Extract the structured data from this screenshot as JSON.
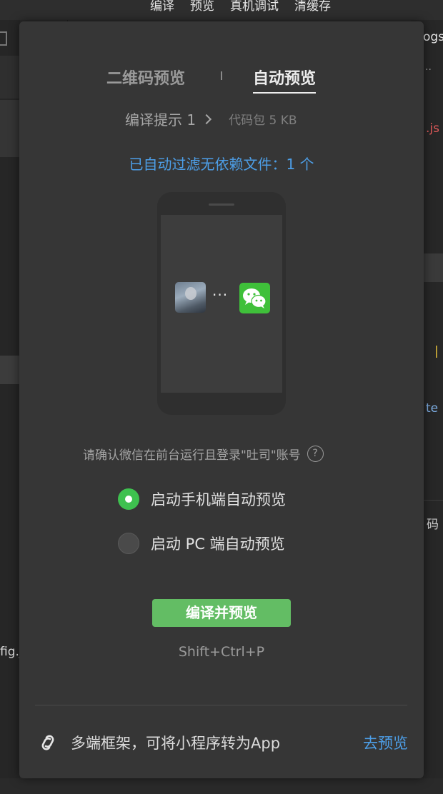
{
  "background": {
    "menu": [
      "编译",
      "预览",
      "真机调试",
      "清缓存"
    ],
    "right_snippets": [
      {
        "text": "ogs",
        "color": "#e6e6e6"
      },
      {
        "text": "..",
        "color": "#9a9a9a"
      },
      {
        "text": ".js",
        "color": "#e05a5a"
      },
      {
        "text": "|",
        "color": "#e8c23a"
      },
      {
        "text": "te",
        "color": "#7fb0e6"
      },
      {
        "text": "码",
        "color": "#cfcfcf"
      }
    ],
    "left_snippet": "fig.j"
  },
  "tabs": {
    "qr": "二维码预览",
    "auto": "自动预览"
  },
  "compile": {
    "hint": "编译提示 1",
    "package": "代码包 5 KB"
  },
  "filter_notice": "已自动过滤无依赖文件：1 个",
  "icons": {
    "avatar": "user-avatar",
    "connector": "···",
    "wechat": "wechat-logo-icon",
    "help": "?",
    "footer": "link-icon"
  },
  "confirm_text": "请确认微信在前台运行且登录\"吐司\"账号",
  "options": {
    "mobile": "启动手机端自动预览",
    "pc": "启动 PC 端自动预览",
    "selected": "mobile"
  },
  "button_label": "编译并预览",
  "shortcut": "Shift+Ctrl+P",
  "footer": {
    "text": "多端框架，可将小程序转为App",
    "link": "去预览"
  },
  "colors": {
    "accent_blue": "#4d9fe8",
    "green": "#63bd64",
    "radio_green": "#3ec14f",
    "panel_bg": "#363636"
  }
}
